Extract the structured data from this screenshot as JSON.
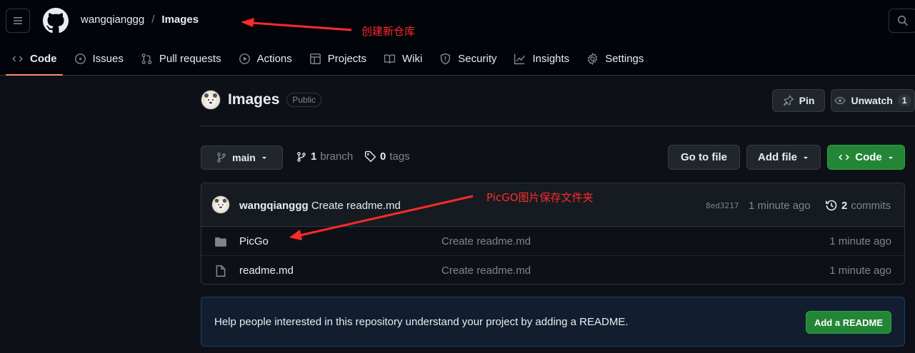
{
  "header": {
    "owner": "wangqianggg",
    "separator": "/",
    "repo": "Images"
  },
  "tabs": [
    {
      "label": "Code",
      "icon": "code-icon",
      "active": true
    },
    {
      "label": "Issues",
      "icon": "issue-icon"
    },
    {
      "label": "Pull requests",
      "icon": "pull-request-icon"
    },
    {
      "label": "Actions",
      "icon": "play-icon"
    },
    {
      "label": "Projects",
      "icon": "table-icon"
    },
    {
      "label": "Wiki",
      "icon": "book-icon"
    },
    {
      "label": "Security",
      "icon": "shield-icon"
    },
    {
      "label": "Insights",
      "icon": "graph-icon"
    },
    {
      "label": "Settings",
      "icon": "gear-icon"
    }
  ],
  "repo_header": {
    "title": "Images",
    "visibility": "Public",
    "pin_label": "Pin",
    "unwatch_label": "Unwatch",
    "watch_count": "1"
  },
  "toolbar": {
    "branch": "main",
    "branch_count": "1",
    "branch_word": "branch",
    "tag_count": "0",
    "tag_word": "tags",
    "goto_file": "Go to file",
    "add_file": "Add file",
    "code_label": "Code"
  },
  "commit": {
    "author": "wangqianggg",
    "message": "Create readme.md",
    "sha": "8ed3217",
    "time": "1 minute ago",
    "commit_count": "2",
    "commit_word": "commits"
  },
  "files": [
    {
      "name": "PicGo",
      "type": "folder",
      "message": "Create readme.md",
      "time": "1 minute ago"
    },
    {
      "name": "readme.md",
      "type": "file",
      "message": "Create readme.md",
      "time": "1 minute ago"
    }
  ],
  "readme_prompt": {
    "text": "Help people interested in this repository understand your project by adding a README.",
    "button": "Add a README"
  },
  "annotations": {
    "create_repo": "创建新仓库",
    "picgo_folder": "PicGO图片保存文件夹",
    "color": "#ff2a2a"
  },
  "colors": {
    "accent_tab": "#fd8c73",
    "green_button": "#238636",
    "background": "#0d1117"
  }
}
